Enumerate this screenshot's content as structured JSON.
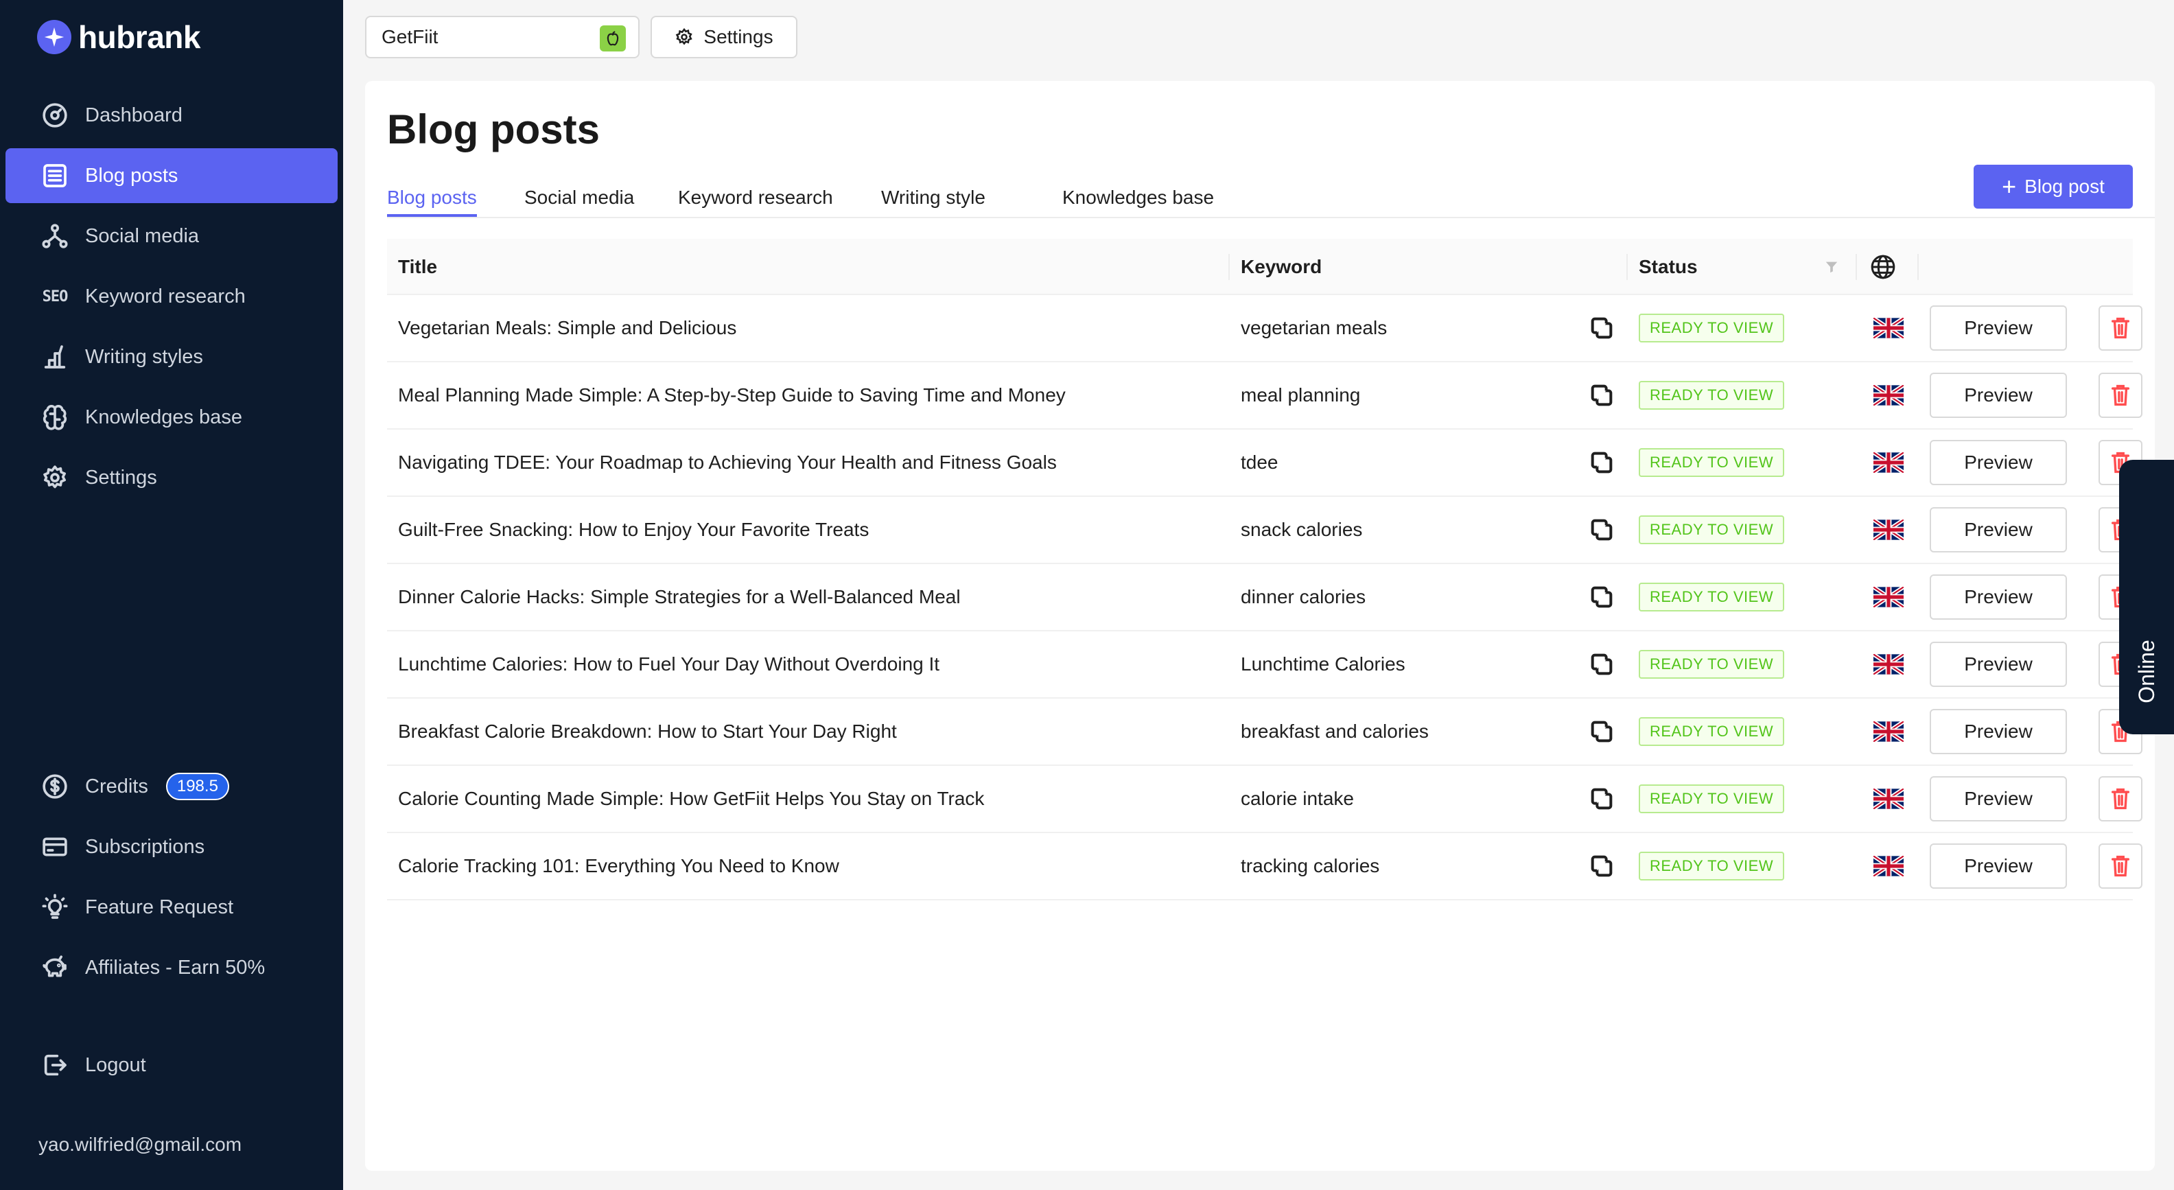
{
  "app": {
    "name": "hubrank"
  },
  "sidebar": {
    "items": [
      {
        "label": "Dashboard",
        "icon": "dashboard-icon"
      },
      {
        "label": "Blog posts",
        "icon": "blog-posts-icon",
        "active": true
      },
      {
        "label": "Social media",
        "icon": "social-media-icon"
      },
      {
        "label": "Keyword research",
        "icon": "seo-icon"
      },
      {
        "label": "Writing styles",
        "icon": "writing-styles-icon"
      },
      {
        "label": "Knowledges base",
        "icon": "brain-icon"
      },
      {
        "label": "Settings",
        "icon": "gear-icon"
      }
    ],
    "bottom_items": [
      {
        "label": "Credits",
        "icon": "dollar-circle-icon",
        "badge": "198.5"
      },
      {
        "label": "Subscriptions",
        "icon": "credit-card-icon"
      },
      {
        "label": "Feature Request",
        "icon": "lightbulb-icon"
      },
      {
        "label": "Affiliates - Earn 50%",
        "icon": "piggy-bank-icon"
      }
    ],
    "logout_label": "Logout",
    "user_email": "yao.wilfried@gmail.com"
  },
  "topbar": {
    "project_name": "GetFiit",
    "settings_label": "Settings"
  },
  "page": {
    "title": "Blog posts",
    "tabs": [
      "Blog posts",
      "Social media",
      "Keyword research",
      "Writing style",
      "Knowledges base"
    ],
    "active_tab": "Blog posts",
    "new_button_label": "Blog post"
  },
  "table": {
    "columns": {
      "title": "Title",
      "keyword": "Keyword",
      "status": "Status"
    },
    "rows": [
      {
        "title": "Vegetarian Meals: Simple and Delicious",
        "keyword": "vegetarian meals",
        "status": "READY TO VIEW",
        "language": "en-GB",
        "action": "Preview"
      },
      {
        "title": "Meal Planning Made Simple: A Step-by-Step Guide to Saving Time and Money",
        "keyword": "meal planning",
        "status": "READY TO VIEW",
        "language": "en-GB",
        "action": "Preview"
      },
      {
        "title": "Navigating TDEE: Your Roadmap to Achieving Your Health and Fitness Goals",
        "keyword": "tdee",
        "status": "READY TO VIEW",
        "language": "en-GB",
        "action": "Preview"
      },
      {
        "title": "Guilt-Free Snacking: How to Enjoy Your Favorite Treats",
        "keyword": "snack calories",
        "status": "READY TO VIEW",
        "language": "en-GB",
        "action": "Preview"
      },
      {
        "title": "Dinner Calorie Hacks: Simple Strategies for a Well-Balanced Meal",
        "keyword": "dinner calories",
        "status": "READY TO VIEW",
        "language": "en-GB",
        "action": "Preview"
      },
      {
        "title": "Lunchtime Calories: How to Fuel Your Day Without Overdoing It",
        "keyword": "Lunchtime Calories",
        "status": "READY TO VIEW",
        "language": "en-GB",
        "action": "Preview"
      },
      {
        "title": "Breakfast Calorie Breakdown: How to Start Your Day Right",
        "keyword": "breakfast and calories",
        "status": "READY TO VIEW",
        "language": "en-GB",
        "action": "Preview"
      },
      {
        "title": "Calorie Counting Made Simple: How GetFiit Helps You Stay on Track",
        "keyword": "calorie intake",
        "status": "READY TO VIEW",
        "language": "en-GB",
        "action": "Preview"
      },
      {
        "title": "Calorie Tracking 101: Everything You Need to Know",
        "keyword": "tracking calories",
        "status": "READY TO VIEW",
        "language": "en-GB",
        "action": "Preview"
      }
    ]
  },
  "online_tab": {
    "label": "Online"
  },
  "colors": {
    "accent": "#5b63f1",
    "sidebar_bg": "#0c1a2e",
    "status_green": "#52c41a",
    "danger": "#ff4d4f"
  }
}
